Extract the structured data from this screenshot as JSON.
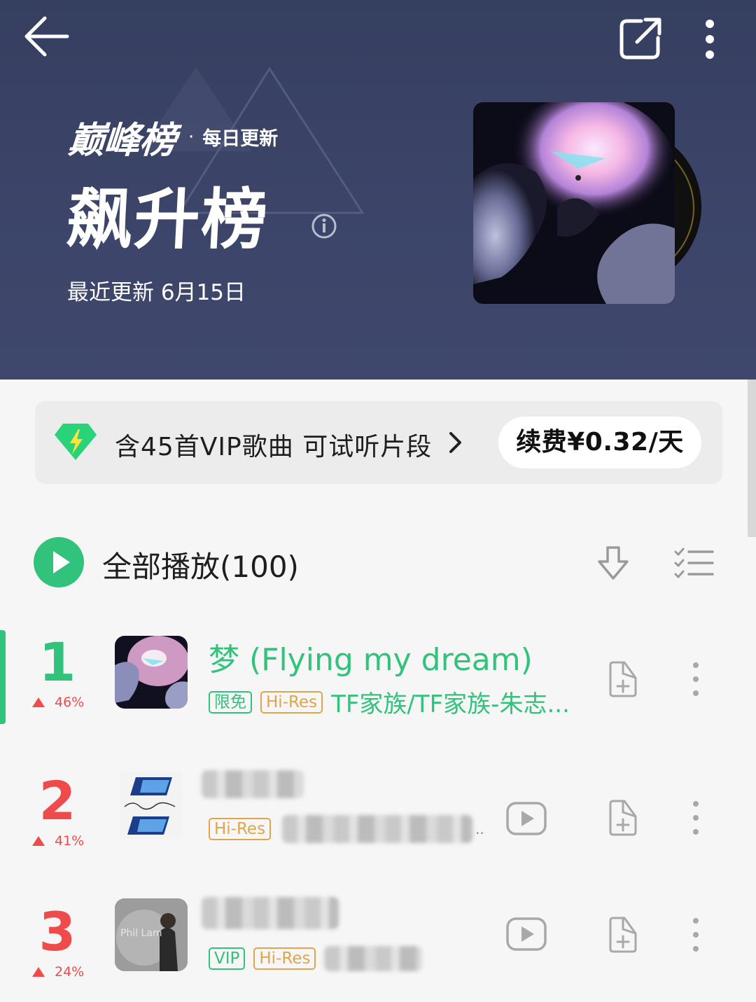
{
  "header": {
    "brand_name": "巅峰榜",
    "separator": "·",
    "brand_tag": "每日更新",
    "chart_title": "飙升榜",
    "updated_text": "最近更新 6月15日",
    "icons": {
      "back": "back-arrow-icon",
      "share": "share-icon",
      "more": "more-vertical-icon",
      "info": "info-icon"
    }
  },
  "vip_banner": {
    "text": "含45首VIP歌曲 可试听片段",
    "renew_label": "续费¥0.32/天",
    "icon": "vip-diamond-icon"
  },
  "play_all": {
    "label": "全部播放(100)",
    "icons": {
      "play": "play-icon",
      "download": "download-icon",
      "multiselect": "multiselect-list-icon"
    }
  },
  "songs": [
    {
      "rank": "1",
      "trend": "46%",
      "title": "梦 (Flying my dream)",
      "tags": [
        "限免",
        "Hi-Res"
      ],
      "artist": "TF家族/TF家族-朱志...",
      "has_mv": false,
      "playing": true
    },
    {
      "rank": "2",
      "trend": "41%",
      "tags": [
        "Hi-Res"
      ],
      "artist_ellipsis": "..",
      "has_mv": true,
      "playing": false
    },
    {
      "rank": "3",
      "trend": "24%",
      "thumb_text": "Phil Lam",
      "tags": [
        "VIP",
        "Hi-Res"
      ],
      "has_mv": true,
      "playing": false
    }
  ],
  "colors": {
    "header_bg": "#3c4569",
    "accent_green": "#31c27c",
    "rank_red": "#ef4b4b",
    "hires_gold": "#e0a54a"
  }
}
